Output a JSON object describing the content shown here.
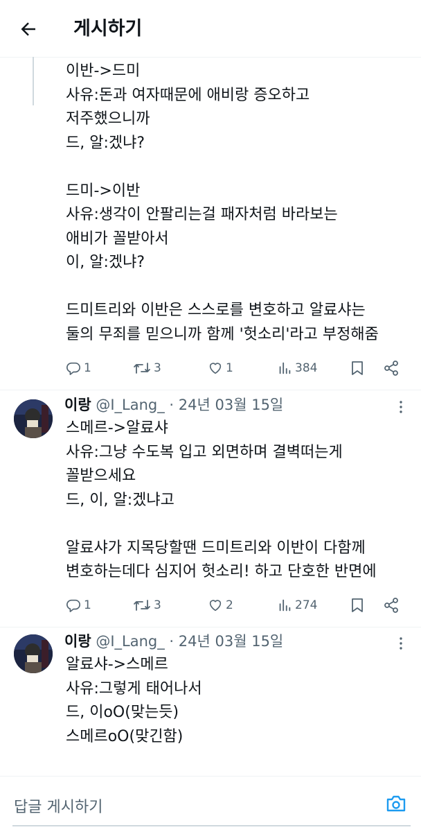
{
  "header": {
    "title": "게시하기",
    "back_icon": "arrow-left-icon"
  },
  "tweets": [
    {
      "lines": [
        "이반->드미",
        "사유:돈과 여자때문에 애비랑 증오하고",
        "저주했으니까",
        "드, 알:겠냐?",
        "",
        "드미->이반",
        "사유:생각이 안팔리는걸 패자처럼 바라보는",
        "애비가 꼴받아서",
        "이, 알:겠냐?",
        "",
        "드미트리와 이반은 스스로를 변호하고 알료샤는",
        "둘의 무죄를 믿으니까 함께 '헛소리'라고 부정해줌"
      ],
      "stats": {
        "replies": "1",
        "retweets": "3",
        "likes": "1",
        "views": "384"
      }
    },
    {
      "author": {
        "name": "이랑",
        "handle": "@I_Lang_",
        "date": "· 24년 03월 15일"
      },
      "lines": [
        "스메르->알료샤",
        "사유:그냥 수도복 입고 외면하며 결벽떠는게",
        "꼴받으세요",
        "드, 이, 알:겠냐고",
        "",
        "알료샤가 지목당할땐 드미트리와 이반이 다함께",
        "변호하는데다 심지어 헛소리! 하고 단호한 반면에"
      ],
      "stats": {
        "replies": "1",
        "retweets": "3",
        "likes": "2",
        "views": "274"
      }
    },
    {
      "author": {
        "name": "이랑",
        "handle": "@I_Lang_",
        "date": "· 24년 03월 15일"
      },
      "lines": [
        "알료샤->스메르",
        "사유:그렇게 태어나서",
        "드, 이oO(맞는듯)",
        "스메르oO(맞긴함)"
      ]
    }
  ],
  "reply": {
    "placeholder": "답글 게시하기",
    "icon": "camera-icon"
  },
  "colors": {
    "text": "#0f1419",
    "muted": "#536471",
    "accent": "#1d9bf0",
    "divider": "#eff3f4"
  }
}
